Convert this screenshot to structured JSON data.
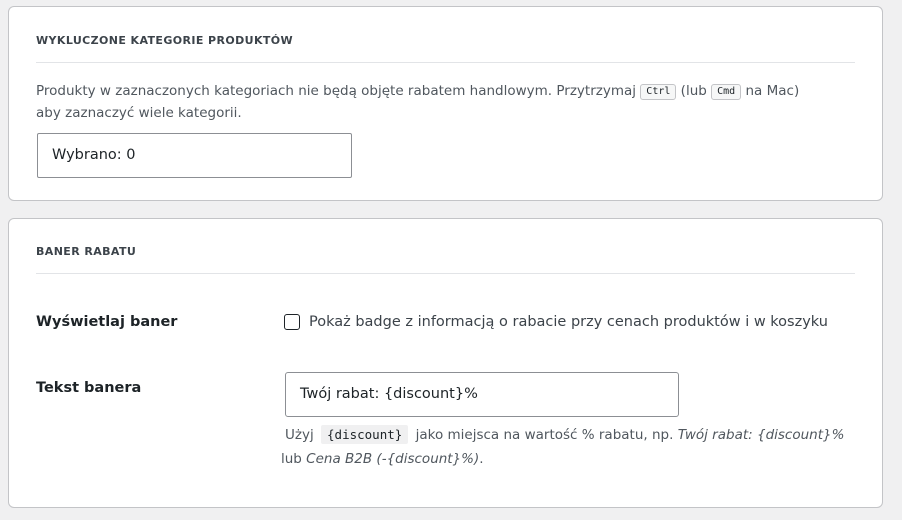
{
  "excluded_categories": {
    "title": "WYKLUCZONE KATEGORIE PRODUKTÓW",
    "description": {
      "text_1": "Produkty w zaznaczonych kategoriach nie będą objęte rabatem handlowym. Przytrzymaj ",
      "kbd_ctrl": "Ctrl",
      "text_2": " (lub ",
      "kbd_cmd": "Cmd",
      "text_3": " na Mac) aby zaznaczyć wiele kategorii."
    },
    "select_value": "Wybrano: 0"
  },
  "discount_banner": {
    "title": "BANER RABATU",
    "display_label": "Wyświetlaj baner",
    "checkbox_checked": false,
    "checkbox_label": "Pokaż badge z informacją o rabacie przy cenach produktów i w koszyku",
    "text_label": "Tekst banera",
    "text_value": "Twój rabat: {discount}%",
    "help": {
      "prefix": "Użyj",
      "code": "{discount}",
      "middle": "jako miejsca na wartość % rabatu, np. ",
      "example_1": "Twój rabat: {discount}%",
      "or": " lub ",
      "example_2": "Cena B2B (-{discount}%)",
      "suffix": "."
    }
  }
}
